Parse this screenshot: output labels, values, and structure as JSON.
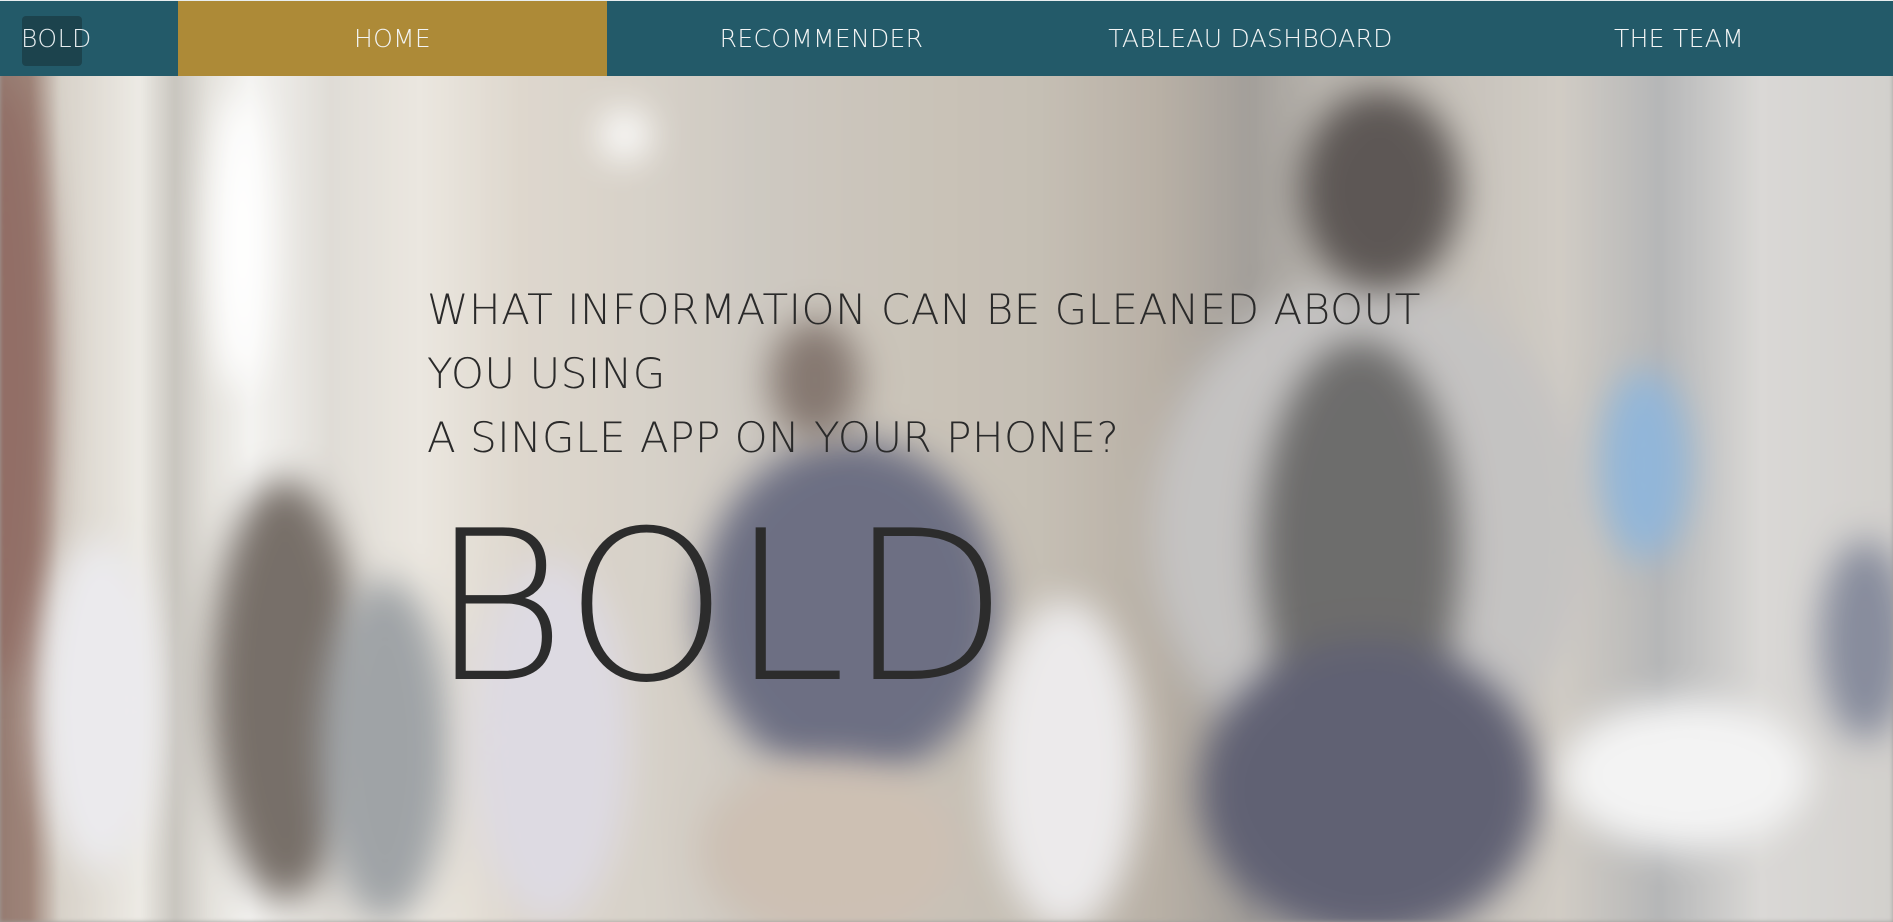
{
  "navbar": {
    "brand": "BOLD",
    "items": [
      {
        "label": "HOME",
        "active": true
      },
      {
        "label": "RECOMMENDER",
        "active": false
      },
      {
        "label": "TABLEAU DASHBOARD",
        "active": false
      },
      {
        "label": "THE TEAM",
        "active": false
      }
    ]
  },
  "hero": {
    "question_lines": [
      "WHAT INFORMATION CAN BE GLEANED ABOUT",
      "YOU USING",
      "A SINGLE APP ON YOUR PHONE?"
    ],
    "title": "BOLD"
  },
  "colors": {
    "navbar_bg": "#235a69",
    "active_tab": "#ad8a37",
    "nav_text": "#f3f5f5",
    "hero_text": "#2a2a2a"
  }
}
